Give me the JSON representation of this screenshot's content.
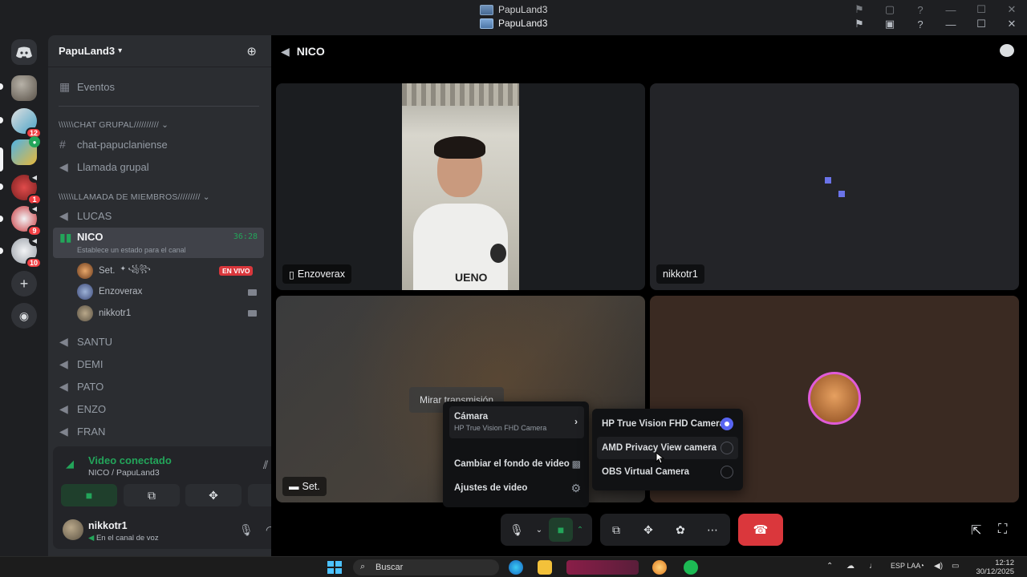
{
  "window": {
    "title": "PapuLand3"
  },
  "server": {
    "name": "PapuLand3",
    "events_label": "Eventos",
    "rail": [
      {
        "name": "home",
        "badge": ""
      },
      {
        "name": "server-1",
        "badge": ""
      },
      {
        "name": "server-2",
        "badge": "12"
      },
      {
        "name": "server-3",
        "badge": ""
      },
      {
        "name": "server-4",
        "badge": "1"
      },
      {
        "name": "server-5",
        "badge": "9"
      },
      {
        "name": "server-6",
        "badge": "10"
      }
    ]
  },
  "categories": [
    {
      "label": "\\\\\\\\\\\\CHAT GRUPAL//////////",
      "channels": [
        "chat-papuclaniense",
        "Llamada grupal"
      ]
    },
    {
      "label": "\\\\\\\\\\\\LLAMADA DE MIEMBROS/////////",
      "channels": [
        "LUCAS"
      ]
    }
  ],
  "active_channel": {
    "name": "NICO",
    "timer": "36:28",
    "status_placeholder": "Establece un estado para el canal",
    "members": [
      {
        "name": "Set.",
        "tag": "✦ ꧁꧂",
        "badge": "EN VIVO"
      },
      {
        "name": "Enzoverax"
      },
      {
        "name": "nikkotr1"
      }
    ]
  },
  "other_channels": [
    "SANTU",
    "DEMI",
    "PATO",
    "ENZO",
    "FRAN"
  ],
  "voice_panel": {
    "title": "Video conectado",
    "subtitle": "NICO / PapuLand3"
  },
  "user": {
    "name": "nikkotr1",
    "status": "En el canal de voz"
  },
  "main": {
    "channel": "NICO",
    "tiles": [
      {
        "label": "Enzoverax"
      },
      {
        "label": "nikkotr1"
      },
      {
        "label": "Set.",
        "overlay_button": "Mirar transmisión"
      },
      {
        "label": ""
      }
    ],
    "video_text": "UENO"
  },
  "camera_menu": {
    "camera_label": "Cámara",
    "camera_current": "HP True Vision FHD Camera",
    "change_bg": "Cambiar el fondo de video",
    "settings": "Ajustes de video",
    "options": [
      {
        "label": "HP True Vision FHD Camera",
        "selected": true
      },
      {
        "label": "AMD Privacy View camera",
        "selected": false
      },
      {
        "label": "OBS Virtual Camera",
        "selected": false
      }
    ]
  },
  "taskbar": {
    "search_placeholder": "Buscar",
    "lang": "ESP LAA",
    "date": "30/12/2025",
    "time": "12:12"
  },
  "colors": {
    "accent": "#5865f2",
    "green": "#23a55a",
    "danger": "#da373c"
  }
}
